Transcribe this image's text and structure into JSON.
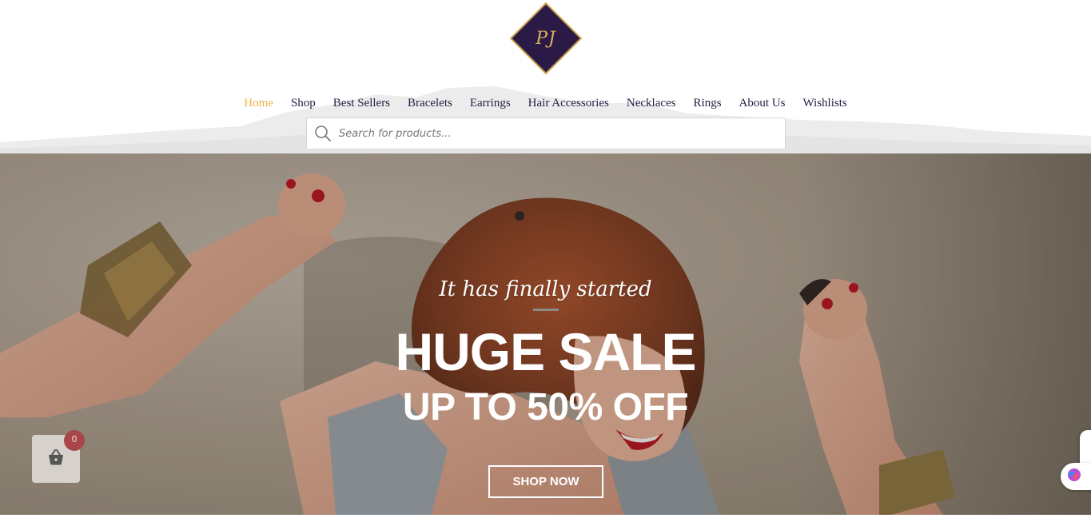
{
  "brand": {
    "logo_text": "PJ",
    "logo_bg": "#2b1a45",
    "logo_gold": "#d9b25c"
  },
  "nav": {
    "items": [
      {
        "label": "Home",
        "active": true
      },
      {
        "label": "Shop"
      },
      {
        "label": "Best Sellers"
      },
      {
        "label": "Bracelets"
      },
      {
        "label": "Earrings"
      },
      {
        "label": "Hair Accessories"
      },
      {
        "label": "Necklaces"
      },
      {
        "label": "Rings"
      },
      {
        "label": "About Us"
      },
      {
        "label": "Wishlists"
      }
    ],
    "active_color": "#f0b34b",
    "color": "#2b1a45"
  },
  "search": {
    "placeholder": "Search for products...",
    "icon": "search-icon"
  },
  "hero": {
    "tagline": "It has finally started",
    "headline": "HUGE SALE",
    "subheadline": "UP TO 50% OFF",
    "cta_label": "SHOP NOW"
  },
  "cart": {
    "count": "0",
    "icon": "basket-icon",
    "badge_color": "#a8464a"
  },
  "side": {
    "chat_icon": "chat-icon"
  }
}
